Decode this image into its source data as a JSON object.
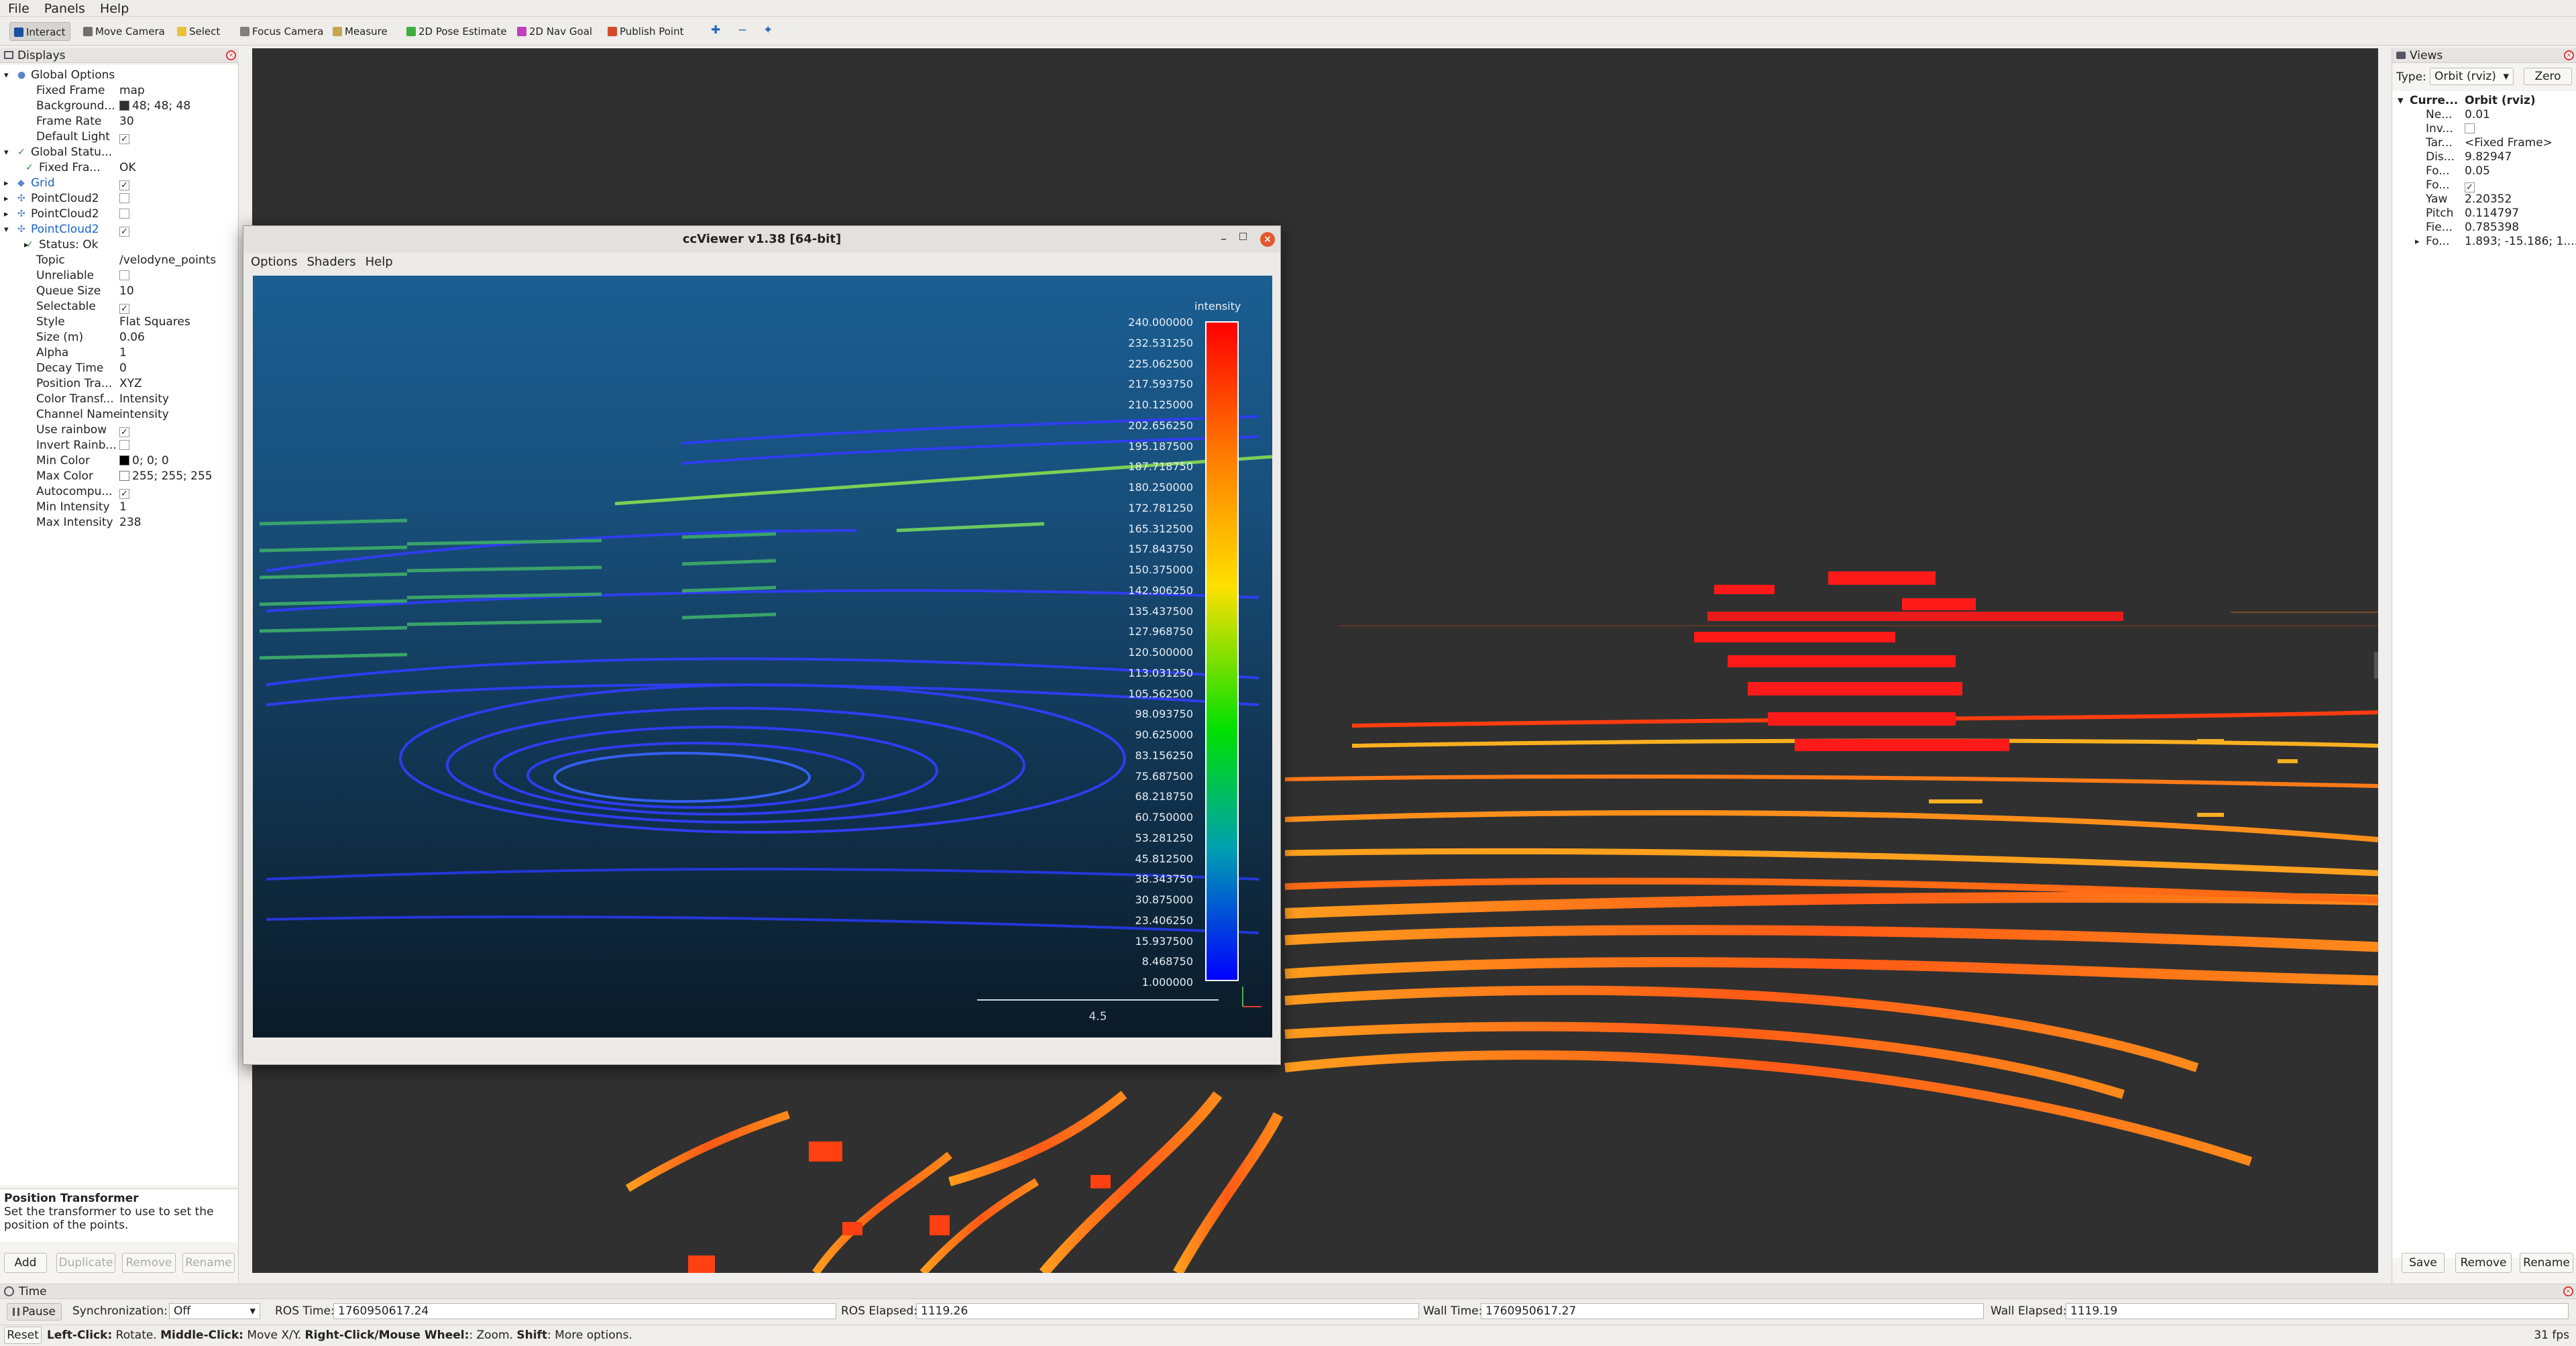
{
  "menubar": [
    "File",
    "Panels",
    "Help"
  ],
  "toolbar": {
    "tools": [
      {
        "label": "Interact",
        "icon": "interact-icon",
        "color": "#1b4fa0",
        "active": true
      },
      {
        "label": "Move Camera",
        "icon": "move-camera-icon",
        "color": "#707070"
      },
      {
        "label": "Select",
        "icon": "select-icon",
        "color": "#e8c33a"
      },
      {
        "label": "Focus Camera",
        "icon": "focus-camera-icon",
        "color": "#808080"
      },
      {
        "label": "Measure",
        "icon": "measure-icon",
        "color": "#c4a550"
      },
      {
        "label": "2D Pose Estimate",
        "icon": "pose-estimate-arrow-icon",
        "color": "#3fae3f"
      },
      {
        "label": "2D Nav Goal",
        "icon": "nav-goal-arrow-icon",
        "color": "#c03fbf"
      },
      {
        "label": "Publish Point",
        "icon": "publish-point-pin-icon",
        "color": "#d24b2a"
      }
    ]
  },
  "displays": {
    "title": "Displays",
    "rows": [
      {
        "key": "Global Options",
        "value": "",
        "indent": 0,
        "expand": "▾",
        "icon": "●"
      },
      {
        "key": "Fixed Frame",
        "value": "map",
        "indent": 2
      },
      {
        "key": "Background...",
        "value": "48; 48; 48",
        "indent": 2,
        "swatch": "#303030"
      },
      {
        "key": "Frame Rate",
        "value": "30",
        "indent": 2
      },
      {
        "key": "Default Light",
        "value": "",
        "indent": 2,
        "check": true
      },
      {
        "key": "Global Statu...",
        "value": "",
        "indent": 0,
        "expand": "▾",
        "icon": "✓"
      },
      {
        "key": "Fixed Fra...",
        "value": "OK",
        "indent": 1,
        "icon": "✓"
      },
      {
        "key": "Grid",
        "value": "",
        "indent": 0,
        "expand": "▸",
        "icon": "◆",
        "check": true,
        "blue": true
      },
      {
        "key": "PointCloud2",
        "value": "",
        "indent": 0,
        "expand": "▸",
        "icon": "✣",
        "check": false
      },
      {
        "key": "PointCloud2",
        "value": "",
        "indent": 0,
        "expand": "▸",
        "icon": "✣",
        "check": false
      },
      {
        "key": "PointCloud2",
        "value": "",
        "indent": 0,
        "expand": "▾",
        "icon": "✣",
        "check": true,
        "blue": true
      },
      {
        "key": "Status: Ok",
        "value": "",
        "indent": 1,
        "expand": "▸",
        "icon": "✓"
      },
      {
        "key": "Topic",
        "value": "/velodyne_points",
        "indent": 2
      },
      {
        "key": "Unreliable",
        "value": "",
        "indent": 2,
        "check": false
      },
      {
        "key": "Queue Size",
        "value": "10",
        "indent": 2
      },
      {
        "key": "Selectable",
        "value": "",
        "indent": 2,
        "check": true
      },
      {
        "key": "Style",
        "value": "Flat Squares",
        "indent": 2
      },
      {
        "key": "Size (m)",
        "value": "0.06",
        "indent": 2
      },
      {
        "key": "Alpha",
        "value": "1",
        "indent": 2
      },
      {
        "key": "Decay Time",
        "value": "0",
        "indent": 2
      },
      {
        "key": "Position Tra...",
        "value": "XYZ",
        "indent": 2
      },
      {
        "key": "Color Transf...",
        "value": "Intensity",
        "indent": 2
      },
      {
        "key": "Channel Name",
        "value": "intensity",
        "indent": 2
      },
      {
        "key": "Use rainbow",
        "value": "",
        "indent": 2,
        "check": true
      },
      {
        "key": "Invert Rainb...",
        "value": "",
        "indent": 2,
        "check": false
      },
      {
        "key": "Min Color",
        "value": "0; 0; 0",
        "indent": 2,
        "swatch": "#000000"
      },
      {
        "key": "Max Color",
        "value": "255; 255; 255",
        "indent": 2,
        "swatch": "#ffffff"
      },
      {
        "key": "Autocompu...",
        "value": "",
        "indent": 2,
        "check": true
      },
      {
        "key": "Min Intensity",
        "value": "1",
        "indent": 2
      },
      {
        "key": "Max Intensity",
        "value": "238",
        "indent": 2
      }
    ],
    "description_title": "Position Transformer",
    "description_text": "Set the transformer to use to set the position of the points.",
    "buttons": [
      "Add",
      "Duplicate",
      "Remove",
      "Rename"
    ]
  },
  "views": {
    "title": "Views",
    "type_label": "Type:",
    "type_value": "Orbit (rviz)",
    "zero_label": "Zero",
    "current_key": "Curre...",
    "current_value": "Orbit (rviz)",
    "rows": [
      {
        "key": "Ne...",
        "value": "0.01"
      },
      {
        "key": "Inv...",
        "value": "",
        "check": false
      },
      {
        "key": "Tar...",
        "value": "<Fixed Frame>"
      },
      {
        "key": "Dis...",
        "value": "9.82947"
      },
      {
        "key": "Fo...",
        "value": "0.05"
      },
      {
        "key": "Fo...",
        "value": "",
        "check": true
      },
      {
        "key": "Yaw",
        "value": "2.20352"
      },
      {
        "key": "Pitch",
        "value": "0.114797"
      },
      {
        "key": "Fie...",
        "value": "0.785398"
      },
      {
        "key": "Fo...",
        "value": "1.893; -15.186; 1....",
        "expand": "▸"
      }
    ],
    "buttons": [
      "Save",
      "Remove",
      "Rename"
    ]
  },
  "time": {
    "title": "Time",
    "pause_label": "Pause",
    "sync_label": "Synchronization:",
    "sync_value": "Off",
    "ros_time_label": "ROS Time:",
    "ros_time": "1760950617.24",
    "ros_elapsed_label": "ROS Elapsed:",
    "ros_elapsed": "1119.26",
    "wall_time_label": "Wall Time:",
    "wall_time": "1760950617.27",
    "wall_elapsed_label": "Wall Elapsed:",
    "wall_elapsed": "1119.19"
  },
  "status": {
    "reset_label": "Reset",
    "hint_1": "Left-Click:",
    "hint_2": " Rotate. ",
    "hint_3": "Middle-Click:",
    "hint_4": " Move X/Y. ",
    "hint_5": "Right-Click/Mouse Wheel:",
    "hint_6": ": Zoom. ",
    "hint_7": "Shift",
    "hint_8": ": More options.",
    "fps": "31 fps"
  },
  "ccviewer": {
    "title": "ccViewer v1.38 [64-bit]",
    "menu": [
      "Options",
      "Shaders",
      "Help"
    ],
    "scale_title": "intensity",
    "scale_labels": [
      "240.000000",
      "232.531250",
      "225.062500",
      "217.593750",
      "210.125000",
      "202.656250",
      "195.187500",
      "187.718750",
      "180.250000",
      "172.781250",
      "165.312500",
      "157.843750",
      "150.375000",
      "142.906250",
      "135.437500",
      "127.968750",
      "120.500000",
      "113.031250",
      "105.562500",
      "98.093750",
      "90.625000",
      "83.156250",
      "75.687500",
      "68.218750",
      "60.750000",
      "53.281250",
      "45.812500",
      "38.343750",
      "30.875000",
      "23.406250",
      "15.937500",
      "8.468750",
      "1.000000"
    ],
    "scale_bar_label": "4.5"
  },
  "colors": {
    "viewport_bg": "#303030",
    "accent_blue": "#1a62c9",
    "close_red": "#d33d2a"
  }
}
